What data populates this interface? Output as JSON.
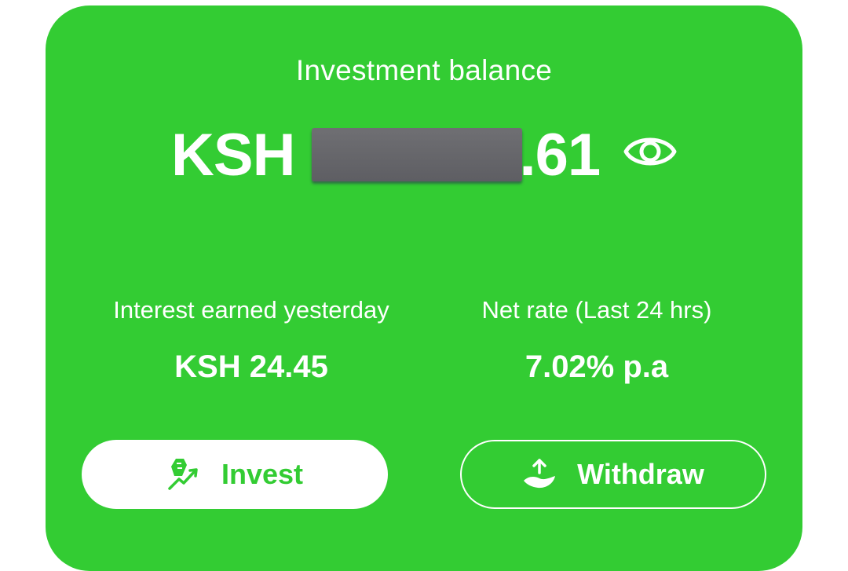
{
  "card": {
    "title": "Investment balance",
    "balance": {
      "currency": "KSH",
      "cents": ".61",
      "visibility_icon": "eye-icon"
    },
    "stats": [
      {
        "label": "Interest earned yesterday",
        "value": "KSH 24.45"
      },
      {
        "label": "Net rate (Last 24 hrs)",
        "value": "7.02% p.a"
      }
    ],
    "buttons": {
      "invest_label": "Invest",
      "invest_icon": "money-growth-icon",
      "withdraw_label": "Withdraw",
      "withdraw_icon": "hand-upload-icon"
    },
    "colors": {
      "background": "#33cc33",
      "text": "#ffffff"
    }
  }
}
